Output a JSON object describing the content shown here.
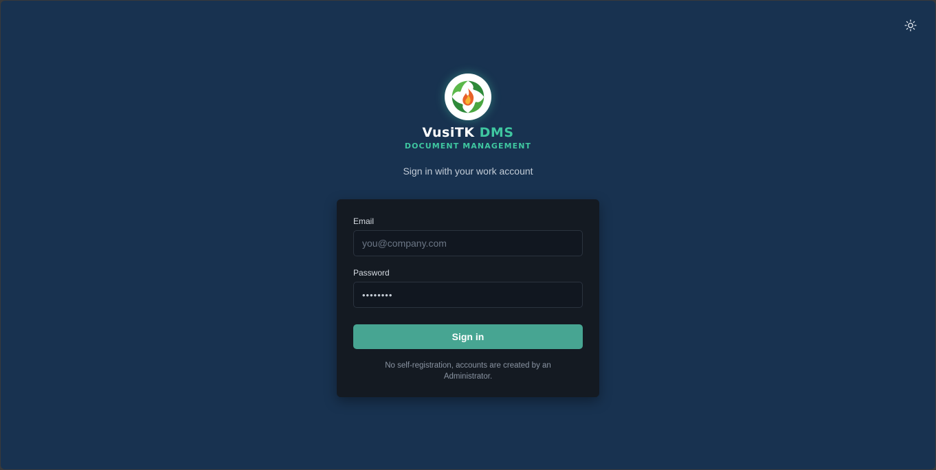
{
  "header": {
    "theme_toggle_icon": "sun-icon"
  },
  "brand": {
    "logo_icon": "recycle-flame-logo",
    "name_part1": "VusiTK",
    "name_part2": "DMS",
    "subtitle": "DOCUMENT MANAGEMENT",
    "tagline": "Sign in with your work account",
    "accent_color": "#3fc7a0"
  },
  "form": {
    "email_label": "Email",
    "email_placeholder": "you@company.com",
    "email_value": "",
    "password_label": "Password",
    "password_value": "••••••••",
    "submit_label": "Sign in",
    "submit_color": "#47a592",
    "note": "No self-registration, accounts are created by an Administrator."
  },
  "colors": {
    "background": "#183250",
    "card": "#141a22"
  }
}
